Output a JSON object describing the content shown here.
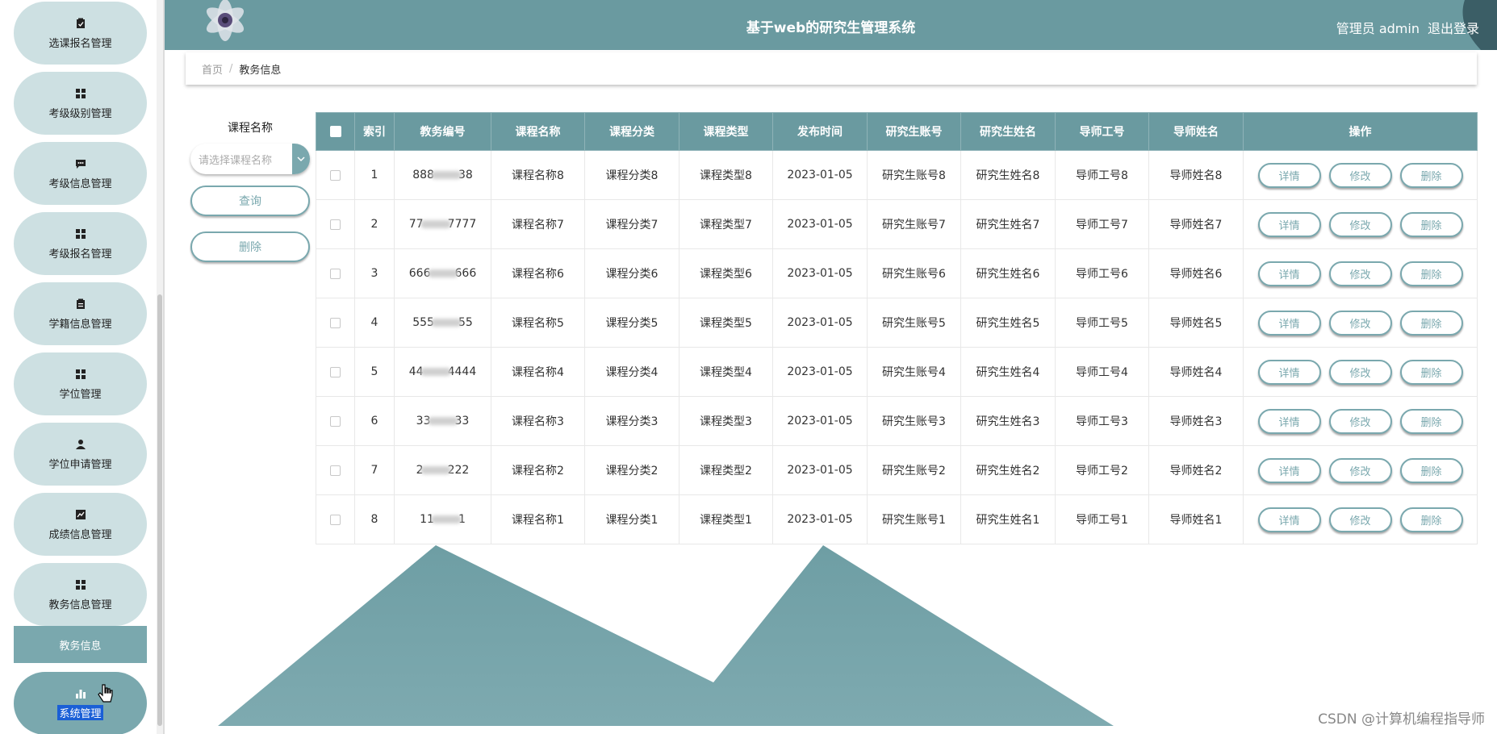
{
  "app": {
    "title": "基于web的研究生管理系统",
    "user_label": "管理员 admin",
    "logout_label": "退出登录"
  },
  "sidebar": {
    "items": [
      {
        "label": "选课报名管理",
        "icon": "clipboard-check-icon"
      },
      {
        "label": "考级级别管理",
        "icon": "grid-icon"
      },
      {
        "label": "考级信息管理",
        "icon": "chat-icon"
      },
      {
        "label": "考级报名管理",
        "icon": "grid-icon"
      },
      {
        "label": "学籍信息管理",
        "icon": "clipboard-icon"
      },
      {
        "label": "学位管理",
        "icon": "grid-icon"
      },
      {
        "label": "学位申请管理",
        "icon": "user-icon"
      },
      {
        "label": "成绩信息管理",
        "icon": "line-chart-icon"
      },
      {
        "label": "教务信息管理",
        "icon": "grid-icon"
      }
    ],
    "submenu_label": "教务信息",
    "last_item": {
      "label": "系统管理",
      "icon": "bar-chart-icon"
    }
  },
  "breadcrumb": {
    "home": "首页",
    "separator": "/",
    "current": "教务信息"
  },
  "search": {
    "label": "课程名称",
    "placeholder": "请选择课程名称",
    "query_button": "查询",
    "delete_button": "删除"
  },
  "table": {
    "headers": [
      "索引",
      "教务编号",
      "课程名称",
      "课程分类",
      "课程类型",
      "发布时间",
      "研究生账号",
      "研究生姓名",
      "导师工号",
      "导师姓名",
      "操作"
    ],
    "rows": [
      {
        "index": "1",
        "id_prefix": "888",
        "id_suffix": "38",
        "course": "课程名称8",
        "category": "课程分类8",
        "type": "课程类型8",
        "date": "2023-01-05",
        "account": "研究生账号8",
        "student": "研究生姓名8",
        "tutor_id": "导师工号8",
        "tutor": "导师姓名8"
      },
      {
        "index": "2",
        "id_prefix": "77",
        "id_suffix": "7777",
        "course": "课程名称7",
        "category": "课程分类7",
        "type": "课程类型7",
        "date": "2023-01-05",
        "account": "研究生账号7",
        "student": "研究生姓名7",
        "tutor_id": "导师工号7",
        "tutor": "导师姓名7"
      },
      {
        "index": "3",
        "id_prefix": "666",
        "id_suffix": "666",
        "course": "课程名称6",
        "category": "课程分类6",
        "type": "课程类型6",
        "date": "2023-01-05",
        "account": "研究生账号6",
        "student": "研究生姓名6",
        "tutor_id": "导师工号6",
        "tutor": "导师姓名6"
      },
      {
        "index": "4",
        "id_prefix": "555",
        "id_suffix": "55",
        "course": "课程名称5",
        "category": "课程分类5",
        "type": "课程类型5",
        "date": "2023-01-05",
        "account": "研究生账号5",
        "student": "研究生姓名5",
        "tutor_id": "导师工号5",
        "tutor": "导师姓名5"
      },
      {
        "index": "5",
        "id_prefix": "44",
        "id_suffix": "4444",
        "course": "课程名称4",
        "category": "课程分类4",
        "type": "课程类型4",
        "date": "2023-01-05",
        "account": "研究生账号4",
        "student": "研究生姓名4",
        "tutor_id": "导师工号4",
        "tutor": "导师姓名4"
      },
      {
        "index": "6",
        "id_prefix": "33",
        "id_suffix": "33",
        "course": "课程名称3",
        "category": "课程分类3",
        "type": "课程类型3",
        "date": "2023-01-05",
        "account": "研究生账号3",
        "student": "研究生姓名3",
        "tutor_id": "导师工号3",
        "tutor": "导师姓名3"
      },
      {
        "index": "7",
        "id_prefix": "2",
        "id_suffix": "222",
        "course": "课程名称2",
        "category": "课程分类2",
        "type": "课程类型2",
        "date": "2023-01-05",
        "account": "研究生账号2",
        "student": "研究生姓名2",
        "tutor_id": "导师工号2",
        "tutor": "导师姓名2"
      },
      {
        "index": "8",
        "id_prefix": "11",
        "id_suffix": "1",
        "course": "课程名称1",
        "category": "课程分类1",
        "type": "课程类型1",
        "date": "2023-01-05",
        "account": "研究生账号1",
        "student": "研究生姓名1",
        "tutor_id": "导师工号1",
        "tutor": "导师姓名1"
      }
    ],
    "actions": {
      "detail": "详情",
      "edit": "修改",
      "delete": "删除"
    }
  },
  "watermark": "CSDN @计算机编程指导师",
  "colors": {
    "primary": "#6a9aa0",
    "accent": "#7aa8ae",
    "menu_bg": "#cde0e2"
  }
}
